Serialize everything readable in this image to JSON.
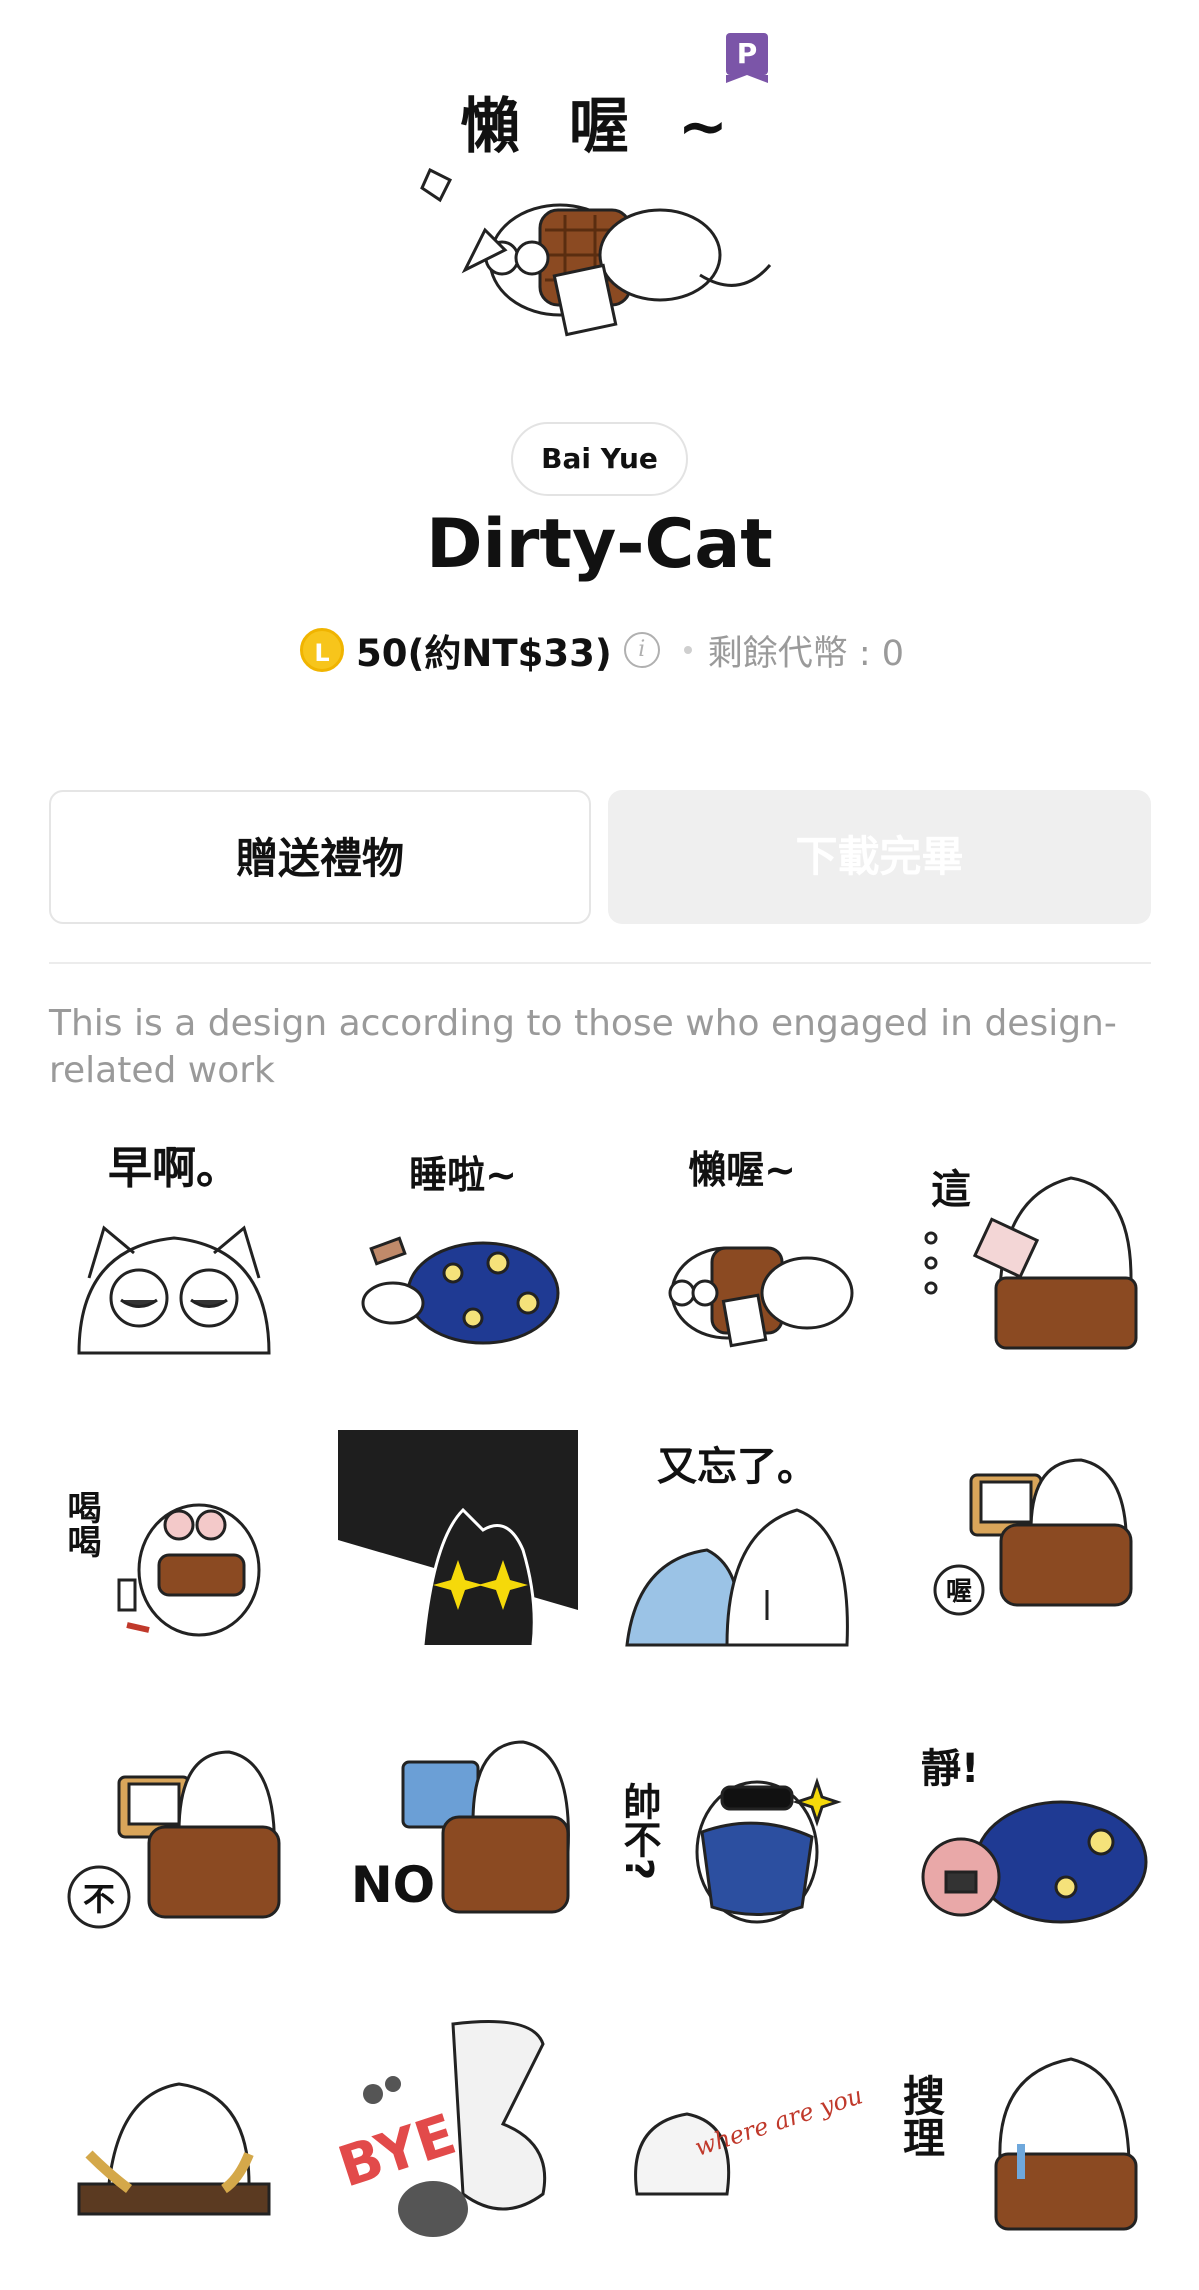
{
  "header": {
    "hero_caption": "懶 喔 ~",
    "premium_badge": "P"
  },
  "author": {
    "name": "Bai Yue"
  },
  "title": "Dirty-Cat",
  "price": {
    "coin_symbol": "L",
    "amount": "50(約NT$33)",
    "info_icon": "i",
    "remaining_tokens": "剩餘代幣 : 0"
  },
  "actions": {
    "gift_label": "贈送禮物",
    "download_label": "下載完畢"
  },
  "description": "This is a design according to those who engaged in design-related work",
  "stickers": [
    {
      "caption": "早啊。"
    },
    {
      "caption": "睡啦~"
    },
    {
      "caption": "懶喔~"
    },
    {
      "caption": "這"
    },
    {
      "caption": "喝喝"
    },
    {
      "caption": ""
    },
    {
      "caption": "又忘了。"
    },
    {
      "caption": "喔"
    },
    {
      "caption": "不"
    },
    {
      "caption": "NO"
    },
    {
      "caption": "帥不?"
    },
    {
      "caption": "靜!"
    },
    {
      "caption": ""
    },
    {
      "caption": "BYE"
    },
    {
      "caption": "where are you ??"
    },
    {
      "caption": "搜理"
    }
  ],
  "colors": {
    "badge_purple": "#7b55a8",
    "coin_yellow": "#f7c51b",
    "disabled_button_bg": "#efefef",
    "muted_text": "#9a9a9a"
  }
}
